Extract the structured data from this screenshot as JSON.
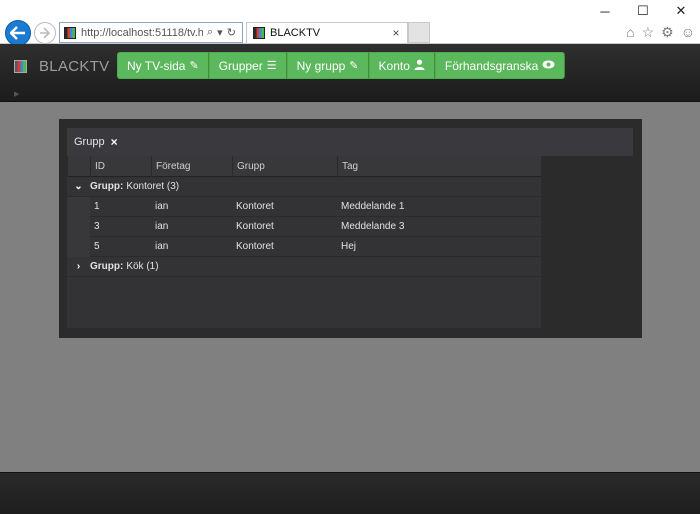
{
  "browser": {
    "url": "http://localhost:51118/tv.htm",
    "tab_title": "BLACKTV",
    "close_glyph": "×",
    "minimize_glyph": "─",
    "maximize_glyph": "☐",
    "window_close_glyph": "✕"
  },
  "navbar": {
    "brand": "BLACKTV",
    "buttons": [
      {
        "label": "Ny TV-sida",
        "icon": "pencil-icon"
      },
      {
        "label": "Grupper",
        "icon": "list-icon"
      },
      {
        "label": "Ny grupp",
        "icon": "pencil-icon"
      },
      {
        "label": "Konto",
        "icon": "user-icon"
      },
      {
        "label": "Förhandsgranska",
        "icon": "eye-icon"
      }
    ]
  },
  "grid": {
    "group_chip": {
      "label": "Grupp",
      "close": "×"
    },
    "columns": [
      "ID",
      "Företag",
      "Grupp",
      "Tag"
    ],
    "groups": [
      {
        "label": "Grupp:",
        "value": "Kontoret (3)",
        "expanded": true,
        "rows": [
          {
            "id": "1",
            "company": "ian",
            "group": "Kontoret",
            "tag": "Meddelande 1"
          },
          {
            "id": "3",
            "company": "ian",
            "group": "Kontoret",
            "tag": "Meddelande 3"
          },
          {
            "id": "5",
            "company": "ian",
            "group": "Kontoret",
            "tag": "Hej"
          }
        ]
      },
      {
        "label": "Grupp:",
        "value": "Kök (1)",
        "expanded": false,
        "rows": []
      }
    ]
  },
  "colors": {
    "accent_green": "#5cb85c",
    "navbar_bg": "#222222",
    "page_bg": "#808080"
  }
}
